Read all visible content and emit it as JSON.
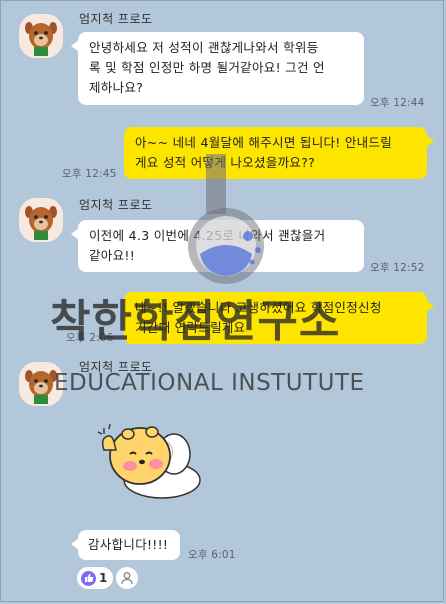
{
  "sender_name": "엄지척 프로도",
  "messages": [
    {
      "text_line1": "안녕하세요 저 성적이 괜찮게나와서 학위등",
      "text_line2": "록 및 학점 인정만 하명 될거같아요! 그건 언",
      "text_line3": "제하나요?",
      "time": "오후 12:44"
    },
    {
      "text_line1": "아~~ 네네 4월달에 해주시면 됩니다! 안내드릴",
      "text_line2": "게요 성적 어떻게 나오셨을까요??",
      "time": "오후 12:45"
    },
    {
      "text_line1": "이전에 4.3 이번에 4.25로 나와서 괜찮을거",
      "text_line2": "같아요!!",
      "time": "오후 12:52"
    },
    {
      "text_line1": "네~!! 알겠습니다 고생하셨어요 학점인정신청",
      "text_line2": "기간때 연락드릴게요",
      "time": "오후 2:06"
    },
    {
      "text": "감사합니다!!!!",
      "time": "오후 6:01"
    }
  ],
  "reactions": {
    "like_count": "1"
  },
  "watermark": {
    "title": "착한학점연구소",
    "subtitle": "EDUCATIONAL INSTUTUTE"
  },
  "icons": {
    "avatar": "frodo-avatar-icon",
    "reaction": "thumbs-up-icon",
    "person": "person-icon",
    "sticker": "choonsik-sticker",
    "logo": "flask-logo-icon"
  },
  "colors": {
    "background": "#b2c7d9",
    "my_bubble": "#fee500",
    "other_bubble": "#ffffff",
    "reaction": "#7b6cf0"
  }
}
